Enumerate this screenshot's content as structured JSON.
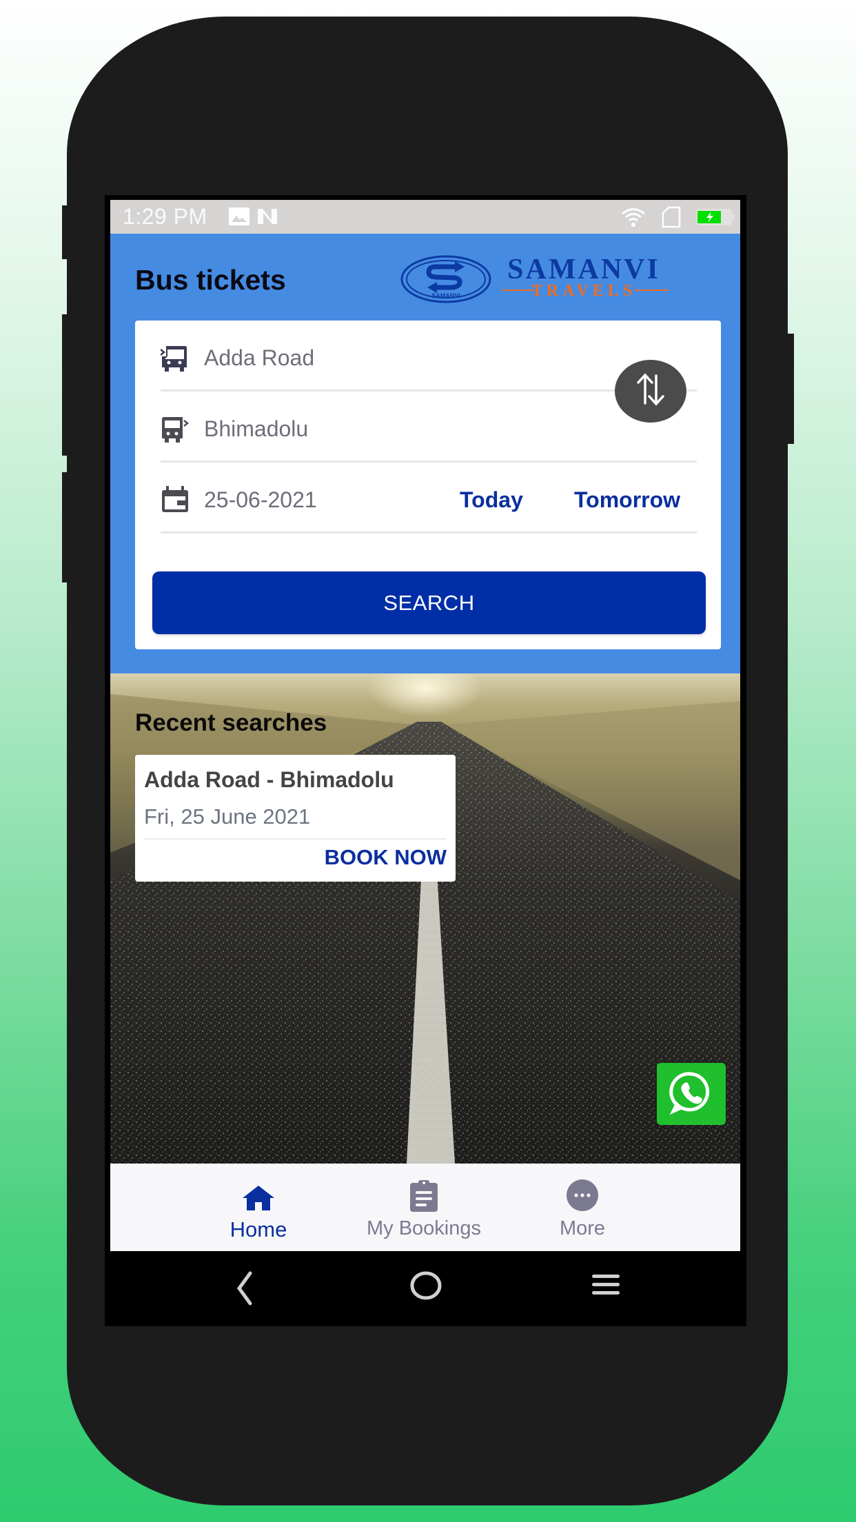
{
  "status_bar": {
    "time": "1:29 PM",
    "left_icons": [
      "image-icon",
      "notification-n-icon"
    ],
    "right_icons": [
      "wifi-icon",
      "sim-card-icon",
      "battery-charging-icon"
    ],
    "battery_color": "#00e000"
  },
  "header": {
    "title": "Bus tickets",
    "logo": {
      "emblem_text": "SAMANVI",
      "brand_top": "SAMANVI",
      "brand_bottom": "TRAVELS",
      "brand_top_color": "#0b3aa3",
      "brand_bottom_color": "#f26b1d"
    },
    "background_color": "#468be2"
  },
  "search_form": {
    "from": {
      "value": "Adda Road",
      "icon": "bus-departure-icon"
    },
    "to": {
      "value": "Bhimadolu",
      "icon": "bus-arrival-icon"
    },
    "date": {
      "value": "25-06-2021",
      "icon": "calendar-icon"
    },
    "today_label": "Today",
    "tomorrow_label": "Tomorrow",
    "swap_icon": "swap-vertical-icon",
    "search_label": "SEARCH",
    "accent_color": "#002ea6"
  },
  "recent_searches": {
    "title": "Recent searches",
    "items": [
      {
        "route": "Adda Road - Bhimadolu",
        "date": "Fri, 25 June 2021",
        "action_label": "BOOK NOW"
      }
    ]
  },
  "floating": {
    "whatsapp_icon": "whatsapp-icon",
    "color": "#1fbf2d"
  },
  "bottom_nav": {
    "tabs": [
      {
        "label": "Home",
        "icon": "home-icon",
        "active": true
      },
      {
        "label": "My Bookings",
        "icon": "clipboard-icon",
        "active": false
      },
      {
        "label": "More",
        "icon": "more-dots-icon",
        "active": false
      }
    ],
    "active_color": "#0a2f9e",
    "inactive_color": "#7c7a90"
  },
  "system_nav": {
    "buttons": [
      "back-icon",
      "home-circle-icon",
      "menu-icon"
    ]
  }
}
